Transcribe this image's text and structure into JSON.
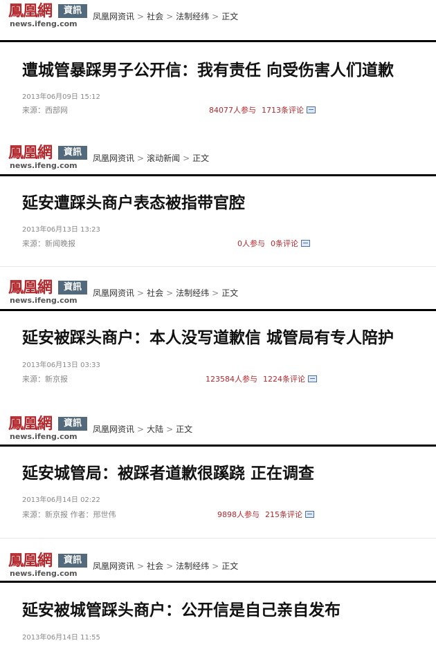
{
  "cards": [
    {
      "logo": {
        "cn": "鳳凰網",
        "badge": "資訊",
        "domain": "news.ifeng.com"
      },
      "breadcrumb": [
        "凤凰网资讯",
        "社会",
        "法制经纬",
        "正文"
      ],
      "title": "遭城管暴踩男子公开信：我有责任  向受伤害人们道歉",
      "date": "2013年06月09日  15:12",
      "source": "来源：西部网",
      "participants": "84077人参与",
      "comments": "1713条评论"
    },
    {
      "logo": {
        "cn": "鳳凰網",
        "badge": "資訊",
        "domain": "news.ifeng.com"
      },
      "breadcrumb": [
        "凤凰网资讯",
        "滚动新闻",
        "正文"
      ],
      "title": "延安遭踩头商户表态被指带官腔",
      "date": "2013年06月13日  13:23",
      "source": "来源：新闻晚报",
      "participants": "0人参与",
      "comments": "0条评论"
    },
    {
      "logo": {
        "cn": "鳳凰網",
        "badge": "資訊",
        "domain": "news.ifeng.com"
      },
      "breadcrumb": [
        "凤凰网资讯",
        "社会",
        "法制经纬",
        "正文"
      ],
      "title": "延安被踩头商户：本人没写道歉信  城管局有专人陪护",
      "date": "2013年06月13日  03:33",
      "source": "来源：新京报",
      "participants": "123584人参与",
      "comments": "1224条评论"
    },
    {
      "logo": {
        "cn": "鳳凰網",
        "badge": "資訊",
        "domain": "news.ifeng.com"
      },
      "breadcrumb": [
        "凤凰网资讯",
        "大陆",
        "正文"
      ],
      "title": "延安城管局：被踩者道歉很蹊跷  正在调查",
      "date": "2013年06月14日  02:22",
      "source": "来源：新京报  作者：邢世伟",
      "participants": "9898人参与",
      "comments": "215条评论"
    },
    {
      "logo": {
        "cn": "鳳凰網",
        "badge": "資訊",
        "domain": "news.ifeng.com"
      },
      "breadcrumb": [
        "凤凰网资讯",
        "社会",
        "法制经纬",
        "正文"
      ],
      "title": "延安被城管踩头商户：公开信是自己亲自发布",
      "date": "2013年06月14日  11:55",
      "source": "",
      "participants": "",
      "comments": ""
    }
  ]
}
